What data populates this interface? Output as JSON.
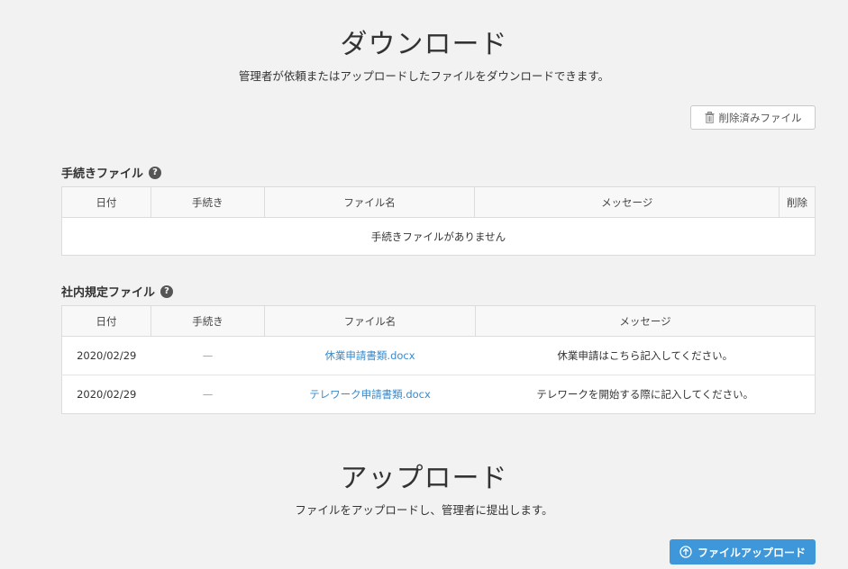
{
  "download": {
    "title": "ダウンロード",
    "subtitle": "管理者が依頼またはアップロードしたファイルをダウンロードできます。",
    "deleted_files_label": "削除済みファイル"
  },
  "procedure_files": {
    "title": "手続きファイル",
    "help": "?",
    "columns": [
      "日付",
      "手続き",
      "ファイル名",
      "メッセージ",
      "削除"
    ],
    "empty_message": "手続きファイルがありません"
  },
  "policy_files": {
    "title": "社内規定ファイル",
    "help": "?",
    "columns": [
      "日付",
      "手続き",
      "ファイル名",
      "メッセージ"
    ],
    "rows": [
      {
        "date": "2020/02/29",
        "procedure": "—",
        "filename": "休業申請書類.docx",
        "message": "休業申請はこちら記入してください。"
      },
      {
        "date": "2020/02/29",
        "procedure": "—",
        "filename": "テレワーク申請書類.docx",
        "message": "テレワークを開始する際に記入してください。"
      }
    ]
  },
  "upload": {
    "title": "アップロード",
    "subtitle": "ファイルをアップロードし、管理者に提出します。",
    "button_label": "ファイルアップロード"
  },
  "colors": {
    "background": "#f2f2f2",
    "link": "#3a8ac9",
    "primary_button": "#3d97d9"
  },
  "icons": {
    "deleted_button": "trash-icon",
    "help": "question-circle-icon",
    "upload_button": "arrow-up-circle-icon"
  }
}
